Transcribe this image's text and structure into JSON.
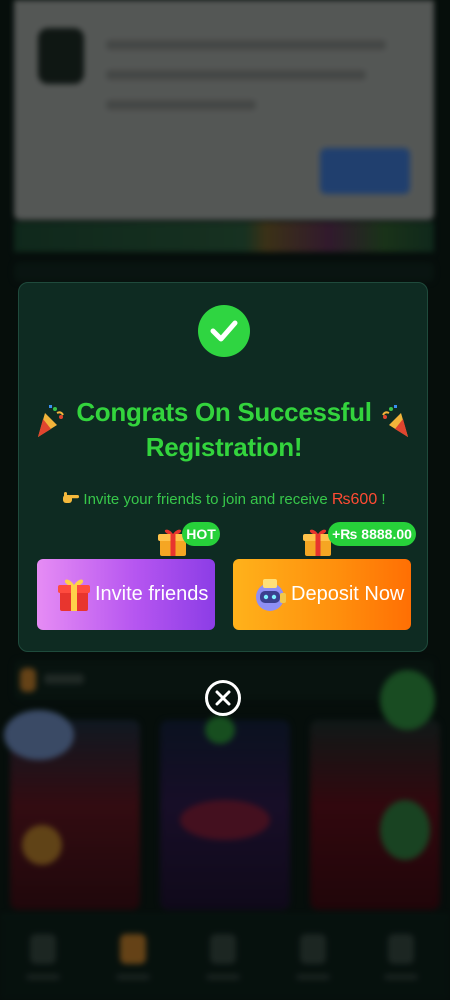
{
  "modal": {
    "title": "Congrats On Successful Registration!",
    "invite_text": "Invite your friends to join and receive ",
    "invite_amount": "₨600",
    "invite_suffix": " !",
    "invite_button": "Invite friends",
    "deposit_button": "Deposit Now",
    "hot_badge": "HOT",
    "bonus_badge": "+₨ 8888.00"
  },
  "colors": {
    "title_green": "#33d43d",
    "invite_gradient_start": "#e68cf4",
    "invite_gradient_end": "#8c3de6",
    "deposit_gradient_start": "#ffb21b",
    "deposit_gradient_end": "#ff6f04",
    "amount_red": "#ff4b33",
    "modal_bg": "#0e2b22"
  },
  "icons": [
    "check-icon",
    "party-popper-icon",
    "pointing-hand-icon",
    "gift-icon",
    "robot-wallet-icon",
    "close-icon"
  ]
}
